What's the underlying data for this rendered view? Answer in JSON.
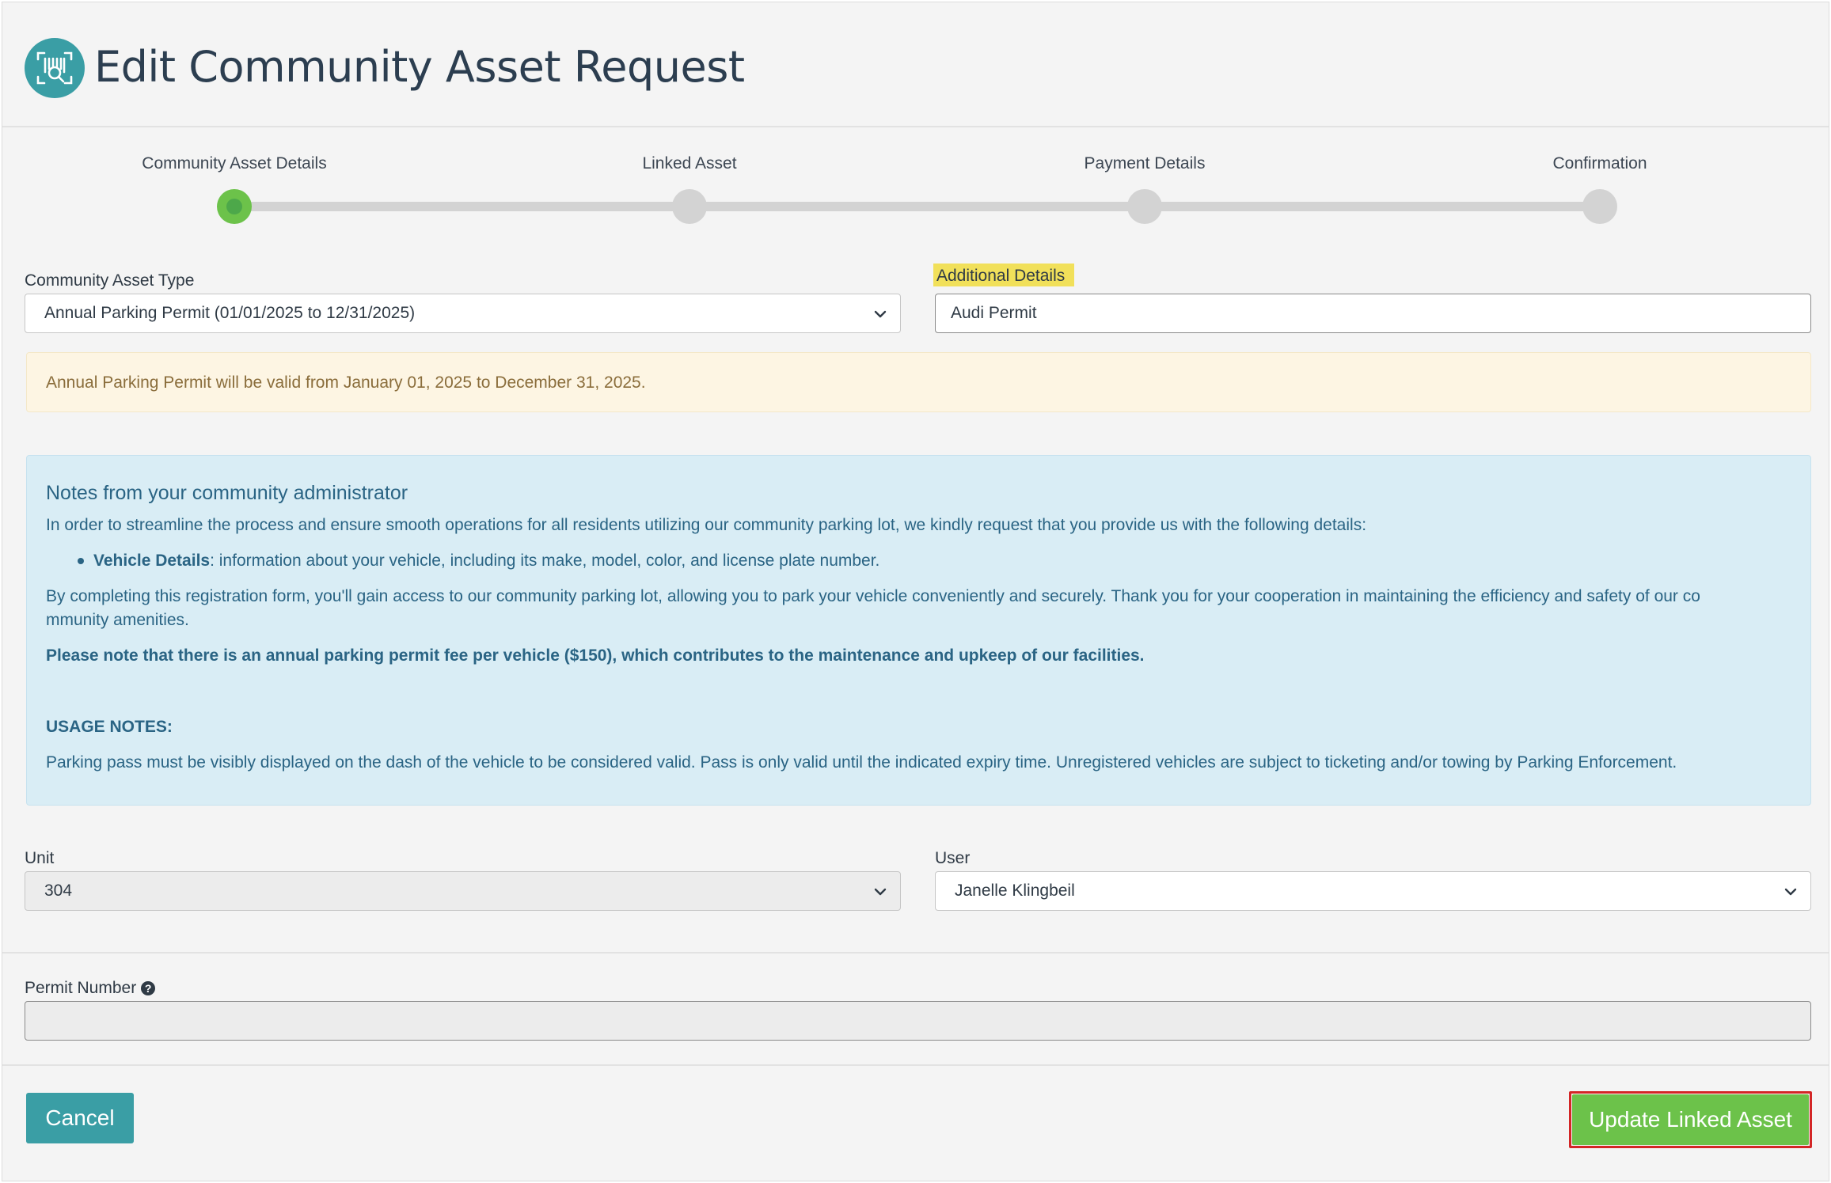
{
  "header": {
    "title": "Edit Community Asset Request",
    "logo_icon": "barcode-scan-icon"
  },
  "stepper": {
    "steps": [
      {
        "label": "Community Asset Details",
        "active": true
      },
      {
        "label": "Linked Asset",
        "active": false
      },
      {
        "label": "Payment Details",
        "active": false
      },
      {
        "label": "Confirmation",
        "active": false
      }
    ]
  },
  "form": {
    "asset_type": {
      "label": "Community Asset Type",
      "value": "Annual Parking Permit (01/01/2025 to 12/31/2025)"
    },
    "additional_details": {
      "label": "Additional Details",
      "value": "Audi Permit"
    },
    "validity_notice": "Annual Parking Permit will be valid from January 01, 2025 to December 31, 2025.",
    "notes": {
      "title": "Notes from your community administrator",
      "intro": "In order to streamline the process and ensure smooth operations for all residents utilizing our community parking lot, we kindly request that you provide us with the following details:",
      "bullet_bold": "Vehicle Details",
      "bullet_rest": ": information about your vehicle, including its make, model, color, and license plate number.",
      "para_line1": "By completing this registration form, you'll gain access to our community parking lot, allowing you to park your vehicle conveniently and securely. Thank you for your cooperation in maintaining the efficiency and safety of our co",
      "para_line2": "mmunity amenities.",
      "fee_note": "Please note that there is an annual parking permit fee per vehicle ($150), which contributes to the maintenance and upkeep of our facilities.",
      "usage_heading": "USAGE NOTES:",
      "usage_text": "Parking pass must be visibly displayed on the dash of the vehicle to be considered valid. Pass is only valid until the indicated expiry time. Unregistered vehicles are subject to ticketing and/or towing by Parking Enforcement."
    },
    "unit": {
      "label": "Unit",
      "value": "304"
    },
    "user": {
      "label": "User",
      "value": "Janelle Klingbeil"
    },
    "permit_number": {
      "label": "Permit Number",
      "value": "",
      "help_icon": "question-circle-icon"
    }
  },
  "actions": {
    "cancel_label": "Cancel",
    "update_label": "Update Linked Asset"
  },
  "colors": {
    "accent": "#3a9ea5",
    "success": "#6cc24a",
    "highlight": "#f1e05a",
    "focus_outline": "#d32626"
  }
}
